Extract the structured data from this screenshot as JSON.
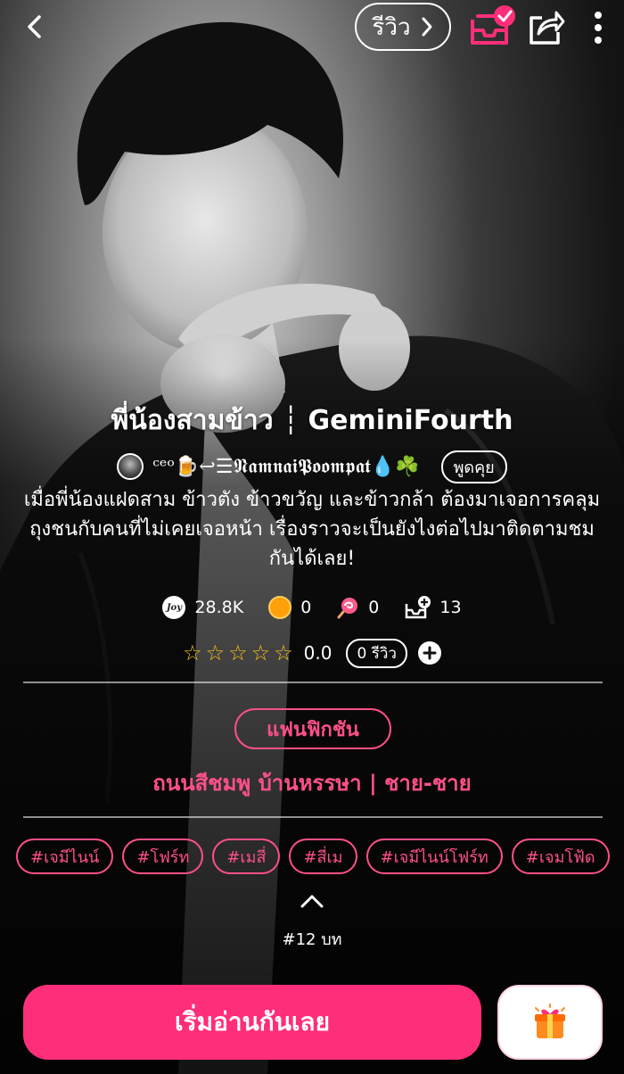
{
  "header": {
    "review_label": "รีวิว"
  },
  "story": {
    "title": "พี่น้องสามข้าว ┆ GeminiFourth",
    "author": "ᶜᵉᵒ🍺↩︎☰𝕹𝖆𝖒𝖓𝖆𝖎𝕻𝖔𝖔𝖒𝖕𝖆𝖙💧☘️",
    "chat_label": "พูดคุย",
    "synopsis": "เมื่อพี่น้องแฝดสาม ข้าวตัง ข้าวขวัญ และข้าวกล้า ต้องมาเจอการคลุม\nถุงชนกับคนที่ไม่เคยเจอหน้า เรื่องราวจะเป็นยังไงต่อไปมาติดตามชม\nกันได้เลย!"
  },
  "stats": {
    "views": "28.8K",
    "coins": "0",
    "candies": "0",
    "library_adds": "13"
  },
  "rating": {
    "stars": "☆☆☆☆☆",
    "score": "0.0",
    "review_count": "0 รีวิว"
  },
  "category": {
    "main": "แฟนฟิกชัน",
    "sub": "ถนนสีชมพู  บ้านหรรษา  |  ชาย-ชาย"
  },
  "tags": [
    "#เจมีไนน์",
    "#โฟร์ท",
    "#เมสี่",
    "#สี่เม",
    "#เจมีไนน์โฟร์ท",
    "#เจมโฟ้ด"
  ],
  "chapters": "#12 บท",
  "actions": {
    "read_label": "เริ่มอ่านกันเลย"
  },
  "icons": {
    "back": "chevron-left-icon",
    "library": "add-to-library-icon",
    "share": "share-icon",
    "more": "more-vertical-icon",
    "gift": "gift-icon"
  },
  "colors": {
    "accent": "#ff2e7a",
    "tag": "#ff4f8b",
    "star": "#f6c11a"
  }
}
